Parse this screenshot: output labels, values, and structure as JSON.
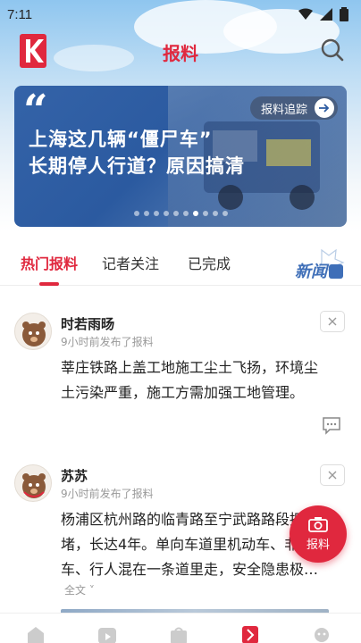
{
  "status_bar": {
    "time": "7:11"
  },
  "header": {
    "title": "报料"
  },
  "banner": {
    "line1": "上海这几辆“僵尸车”",
    "line2": "长期停人行道？原因搞清",
    "tag_label": "报料追踪",
    "page_count": 10,
    "active_page": 7
  },
  "tabs": [
    {
      "label": "热门报料",
      "active": true
    },
    {
      "label": "记者关注",
      "active": false
    },
    {
      "label": "已完成",
      "active": false
    }
  ],
  "posts": [
    {
      "user": "时若雨旸",
      "time": "9小时前发布了报料",
      "content": "莘庄铁路上盖工地施工尘土飞扬，环境尘土污染严重，施工方需加强工地管理。"
    },
    {
      "user": "苏苏",
      "time": "9小时前发布了报料",
      "content": "杨浦区杭州路的临青路至宁武路路段拥堵，长达4年。单向车道里机动车、非机动车、行人混在一条道里走，安全隐患极…",
      "expand_label": "全文"
    }
  ],
  "fab": {
    "label": "报料"
  },
  "colors": {
    "accent": "#e0283e",
    "banner_blue": "#2b5aa0"
  }
}
